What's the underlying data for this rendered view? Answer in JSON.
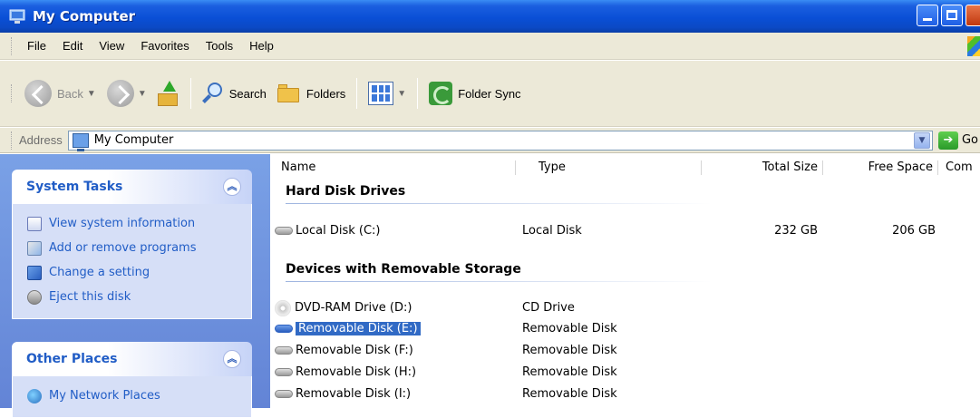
{
  "window": {
    "title": "My Computer"
  },
  "menu": [
    "File",
    "Edit",
    "View",
    "Favorites",
    "Tools",
    "Help"
  ],
  "toolbar": {
    "back": "Back",
    "search": "Search",
    "folders": "Folders",
    "folder_sync": "Folder Sync"
  },
  "address": {
    "label": "Address",
    "value": "My Computer",
    "go": "Go"
  },
  "system_tasks": {
    "title": "System Tasks",
    "items": [
      {
        "label": "View system information",
        "icon": "system-info-icon"
      },
      {
        "label": "Add or remove programs",
        "icon": "add-remove-programs-icon"
      },
      {
        "label": "Change a setting",
        "icon": "control-panel-icon"
      },
      {
        "label": "Eject this disk",
        "icon": "eject-disk-icon"
      }
    ]
  },
  "other_places": {
    "title": "Other Places",
    "items": [
      {
        "label": "My Network Places",
        "icon": "network-places-icon"
      }
    ]
  },
  "columns": {
    "name": "Name",
    "type": "Type",
    "total_size": "Total Size",
    "free_space": "Free Space",
    "comments": "Com"
  },
  "groups": {
    "hard_disk": "Hard Disk Drives",
    "removable": "Devices with Removable Storage"
  },
  "hard_disks": [
    {
      "name": "Local Disk (C:)",
      "type": "Local Disk",
      "total": "232 GB",
      "free": "206 GB"
    }
  ],
  "removable_devices": [
    {
      "name": "DVD-RAM Drive (D:)",
      "type": "CD Drive"
    },
    {
      "name": "Removable Disk (E:)",
      "type": "Removable Disk",
      "selected": true
    },
    {
      "name": "Removable Disk (F:)",
      "type": "Removable Disk"
    },
    {
      "name": "Removable Disk (H:)",
      "type": "Removable Disk"
    },
    {
      "name": "Removable Disk (I:)",
      "type": "Removable Disk"
    }
  ],
  "colors": {
    "title_blue": "#0a4fd6",
    "selection": "#316ac5",
    "task_link": "#215dc6",
    "pane_bg": "#6b8fdc"
  }
}
